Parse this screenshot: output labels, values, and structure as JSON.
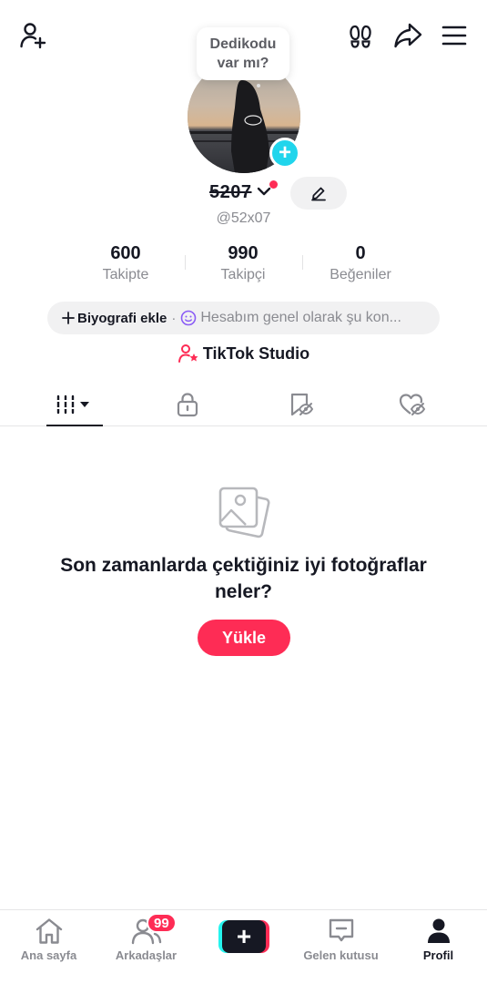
{
  "header": {
    "add_friend_icon": "person-plus-icon",
    "footprints_icon": "footprints-icon",
    "share_icon": "share-arrow-icon",
    "menu_icon": "hamburger-menu-icon"
  },
  "bubble": {
    "text": "Dedikodu var mı?"
  },
  "profile": {
    "username": "5207",
    "handle": "@52x07",
    "stats": [
      {
        "value": "600",
        "label": "Takipte"
      },
      {
        "value": "990",
        "label": "Takipçi"
      },
      {
        "value": "0",
        "label": "Beğeniler"
      }
    ],
    "bio_add_label": "Biyografi ekle",
    "bio_separator": "·",
    "bio_hint": "Hesabım genel olarak şu kon...",
    "studio_label": "TikTok Studio"
  },
  "tabs": [
    {
      "icon": "grid-icon",
      "active": true
    },
    {
      "icon": "lock-icon",
      "active": false
    },
    {
      "icon": "bookmark-eye-icon",
      "active": false
    },
    {
      "icon": "heart-eye-icon",
      "active": false
    }
  ],
  "empty_state": {
    "icon": "photos-icon",
    "message": "Son zamanlarda çektiğiniz iyi fotoğraflar neler?",
    "button_label": "Yükle"
  },
  "bottom_nav": {
    "items": [
      {
        "label": "Ana sayfa",
        "icon": "home-icon"
      },
      {
        "label": "Arkadaşlar",
        "icon": "friends-icon"
      },
      {
        "label": "",
        "icon": "create-plus-icon"
      },
      {
        "label": "Gelen kutusu",
        "icon": "inbox-icon"
      },
      {
        "label": "Profil",
        "icon": "profile-icon"
      }
    ],
    "friends_badge": "99"
  },
  "colors": {
    "accent": "#fe2c55",
    "cyan": "#25f4ee",
    "text_primary": "#161823",
    "text_secondary": "#8a8b91"
  }
}
